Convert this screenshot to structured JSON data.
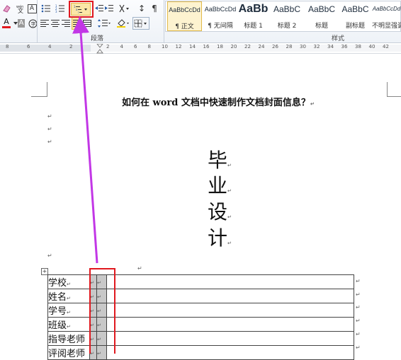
{
  "ribbon": {
    "groups": {
      "paragraph": "段落",
      "styles": "样式"
    },
    "styles": [
      {
        "preview": "AaBbCcDd",
        "name": "¶ 正文"
      },
      {
        "preview": "AaBbCcDd",
        "name": "¶ 无间隔"
      },
      {
        "preview": "AaBb",
        "name": "标题 1"
      },
      {
        "preview": "AaBbC",
        "name": "标题 2"
      },
      {
        "preview": "AaBbC",
        "name": "标题"
      },
      {
        "preview": "AaBbC",
        "name": "副标题"
      },
      {
        "preview": "AaBbCcDd",
        "name": "不明显强调"
      }
    ],
    "icons": {
      "text_color_icon": "A",
      "char_shading_icon": "A",
      "text_box_icon": "A",
      "zoom_icon": "A",
      "sort_icon": "↕",
      "show_marks_icon": "¶"
    }
  },
  "ruler": {
    "numbers": [
      "8",
      "6",
      "4",
      "2",
      "2",
      "4",
      "6",
      "8",
      "10",
      "12",
      "14",
      "16",
      "18",
      "20",
      "22",
      "24",
      "26",
      "28",
      "30",
      "32",
      "34",
      "36",
      "38",
      "40",
      "42"
    ]
  },
  "document": {
    "title": "如何在 word 文档中快速制作文档封面信息？",
    "paragraph_mark": "↵",
    "big_title": [
      "毕",
      "业",
      "设",
      "计"
    ],
    "table_rows": [
      "学校",
      "姓名",
      "学号",
      "班级",
      "指导老师",
      "评阅老师"
    ]
  },
  "annotation": {
    "color": "#e0191f",
    "arrow_color": "#c237e6"
  }
}
